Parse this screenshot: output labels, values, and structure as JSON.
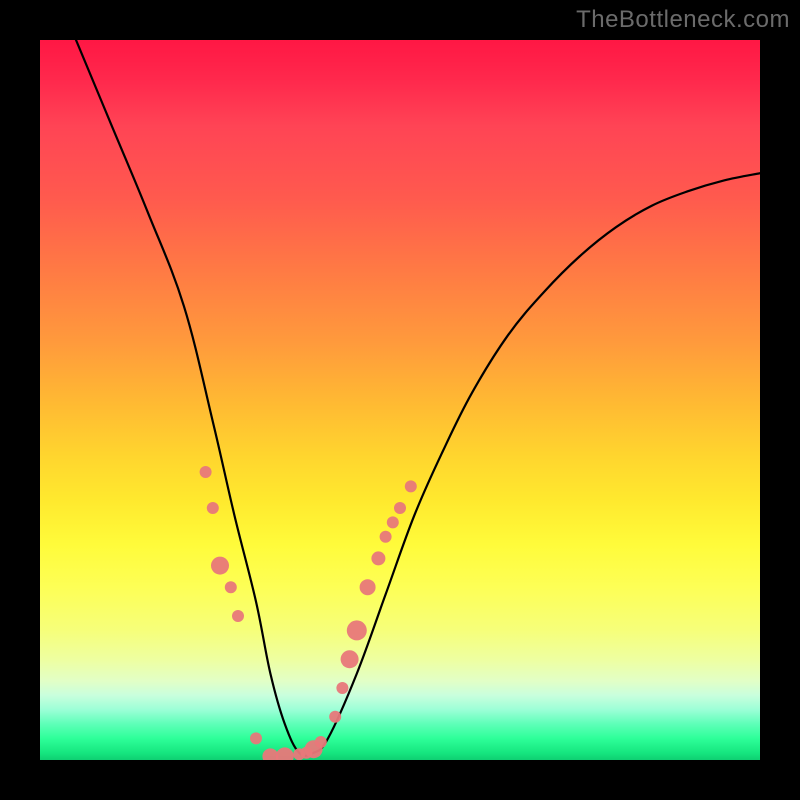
{
  "watermark": "TheBottleneck.com",
  "chart_data": {
    "type": "line",
    "title": "",
    "xlabel": "",
    "ylabel": "",
    "xlim": [
      0,
      100
    ],
    "ylim": [
      0,
      100
    ],
    "series": [
      {
        "name": "bottleneck-curve",
        "x": [
          5,
          10,
          15,
          20,
          24,
          27,
          30,
          32,
          34,
          36,
          38,
          40,
          44,
          48,
          52,
          56,
          60,
          65,
          70,
          75,
          80,
          85,
          90,
          95,
          100
        ],
        "y": [
          100,
          88,
          76,
          63,
          47,
          34,
          22,
          12,
          5,
          1,
          1,
          3,
          12,
          23,
          34,
          43,
          51,
          59,
          65,
          70,
          74,
          77,
          79,
          80.5,
          81.5
        ]
      }
    ],
    "markers": {
      "name": "marker-dots",
      "color": "#e8787a",
      "x": [
        23,
        24,
        25,
        26.5,
        27.5,
        30,
        32,
        34,
        36,
        37,
        38,
        39,
        41,
        42,
        43,
        44,
        45.5,
        47,
        48,
        49,
        50,
        51.5
      ],
      "y": [
        40,
        35,
        27,
        24,
        20,
        3,
        0.5,
        0.5,
        0.8,
        1,
        1.5,
        2.5,
        6,
        10,
        14,
        18,
        24,
        28,
        31,
        33,
        35,
        38
      ],
      "r": [
        6,
        6,
        9,
        6,
        6,
        6,
        8,
        9,
        6,
        6,
        9,
        6,
        6,
        6,
        9,
        10,
        8,
        7,
        6,
        6,
        6,
        6
      ]
    },
    "gradient_stops": [
      {
        "pos": 0,
        "color": "#ff1744"
      },
      {
        "pos": 50,
        "color": "#ffb833"
      },
      {
        "pos": 70,
        "color": "#fffb3a"
      },
      {
        "pos": 95,
        "color": "#5effb8"
      },
      {
        "pos": 100,
        "color": "#0fcf72"
      }
    ]
  }
}
